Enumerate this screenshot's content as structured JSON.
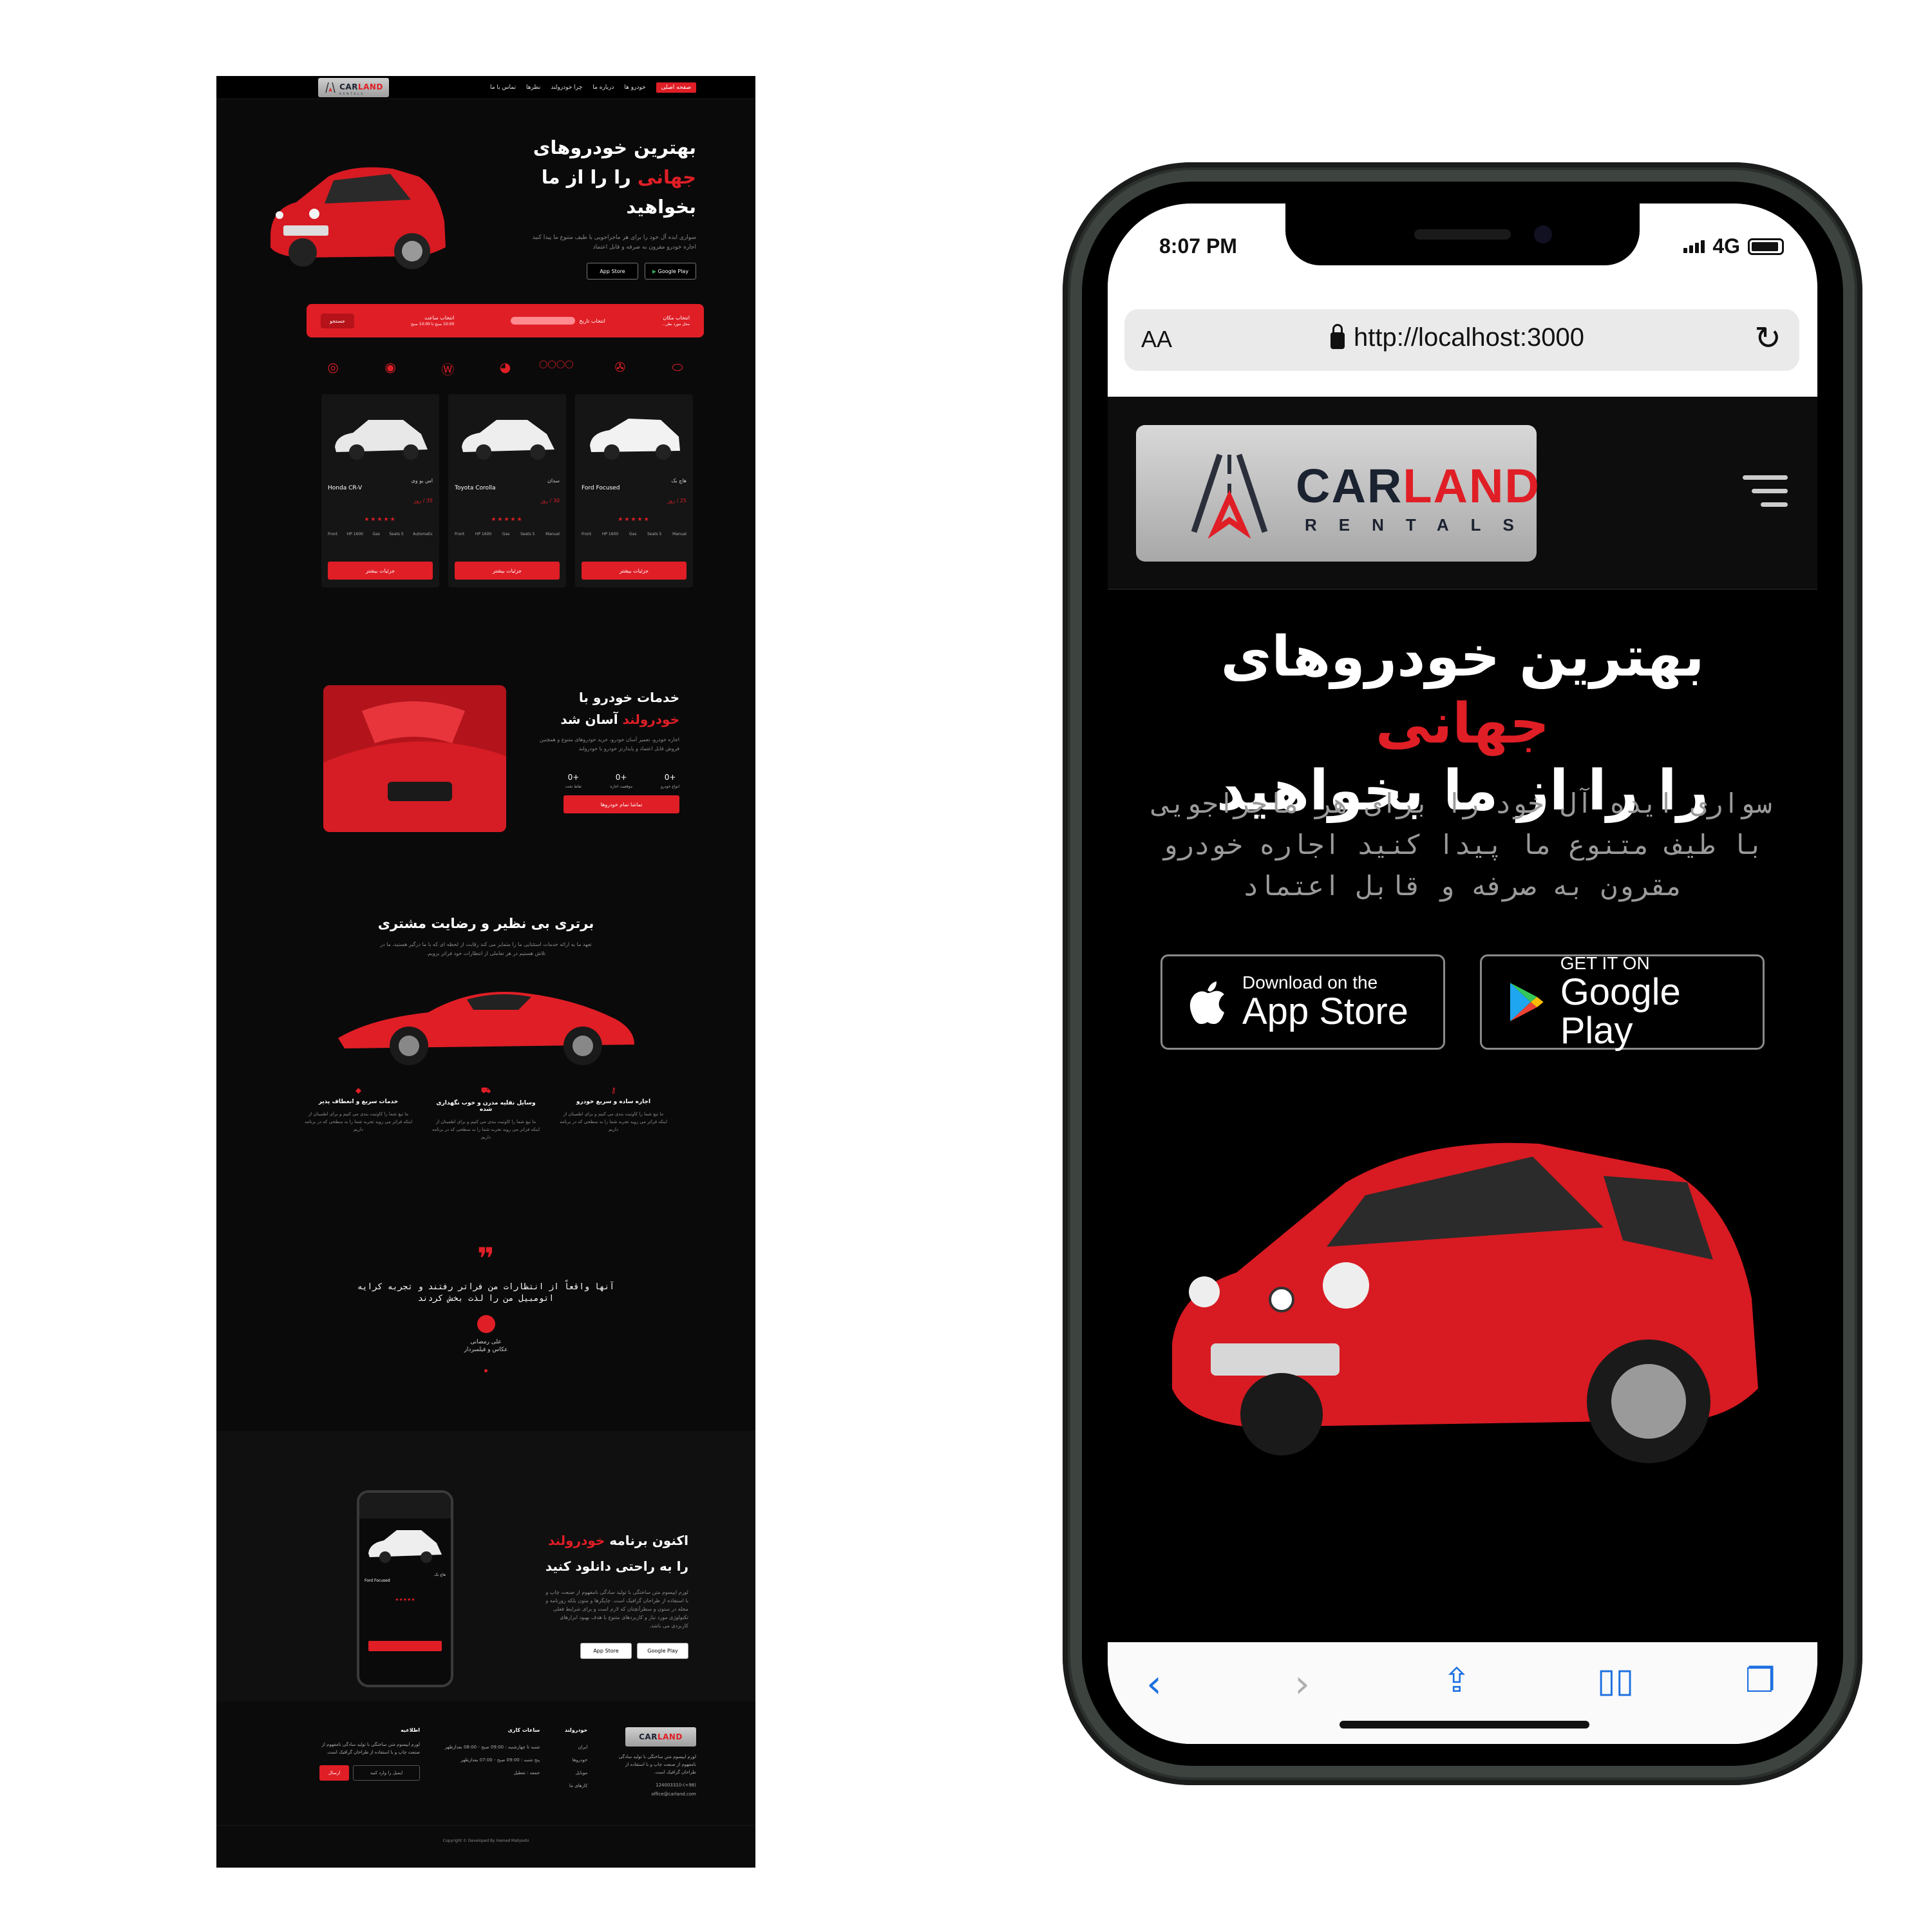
{
  "desktop": {
    "nav": {
      "logo_word_a": "CAR",
      "logo_word_b": "LAND",
      "logo_sub": "RENTALS",
      "links": [
        "صفحه اصلی",
        "خودرو ها",
        "درباره ما",
        "چرا خودرولند",
        "نظرها",
        "تماس با ما"
      ]
    },
    "hero": {
      "title_line1": "بهترین خودروهای",
      "title_red": "جهانی",
      "title_line2b": " را را از ما",
      "title_line3": "بخواهید",
      "desc": "سواری ایده آل خود را برای هر ماجراجویی با طیف متنوع ما پیدا کنید اجاره خودرو مقرون به صرفه و قابل اعتماد",
      "appstore": "App Store",
      "googleplay": "Google Play"
    },
    "search": {
      "location_label": "انتخاب مکان",
      "location_value": "محل مورد نظر...",
      "date_label": "انتخاب تاریخ",
      "time_label": "انتخاب ساعت",
      "time_value": "10:00 صبح  تا  10:00 صبح",
      "button": "جستجو"
    },
    "cards": [
      {
        "type": "هاچ بک",
        "name": "Ford Focused",
        "price": "25 / روز",
        "feats": [
          "Front",
          "HP 1600",
          "Gas",
          "Seats 5",
          "Manual"
        ],
        "cta": "جزئیات بیشتر"
      },
      {
        "type": "سدان",
        "name": "Toyota Corolla",
        "price": "30 / روز",
        "feats": [
          "Front",
          "HP 1600",
          "Gas",
          "Seats 5",
          "Manual"
        ],
        "cta": "جزئیات بیشتر"
      },
      {
        "type": "اس یو وی",
        "name": "Honda CR-V",
        "price": "35 / روز",
        "feats": [
          "Front",
          "HP 1600",
          "Gas",
          "Seats 5",
          "Automatic"
        ],
        "cta": "جزئیات بیشتر"
      }
    ],
    "services": {
      "title_a": "خدمات خودرو با",
      "title_red": "خودرولند",
      "title_b": " آسان شد",
      "desc": "اجاره خودرو، تعمیر آسان خودرو، خرید خودروهای متنوع و همچنین فروش قابل اعتماد و پایدارتر خودرو با خودرولند",
      "stats": [
        {
          "value": "+0",
          "label": "انواع خودرو"
        },
        {
          "value": "+0",
          "label": "موقعیت اجاره"
        },
        {
          "value": "+0",
          "label": "نقاط تحت"
        }
      ],
      "all_button": "تماشا تمام خودروها"
    },
    "quality": {
      "title": "برتری بی نظیر و رضایت مشتری",
      "desc": "تعهد ما به ارائه خدمات استثنایی ما را متمایز می کند رقابت از لحظه ای که با ما درگیر هستید، ما در تلاش هستیم در هر تعاملی از انتظارات خود فراتر برویم.",
      "features": [
        {
          "title": "اجاره ساده و سریع خودرو",
          "desc": "ما تیغ شما را کاوتیت بندی می کنیم و برای اطمینان از اینکه فراتر می روید تجربه شما را به سطحی که در برنامه داریم"
        },
        {
          "title": "وسایل نقلیه مدرن و خوب نگهداری شده",
          "desc": "ما تیغ شما را کاوتیت بندی می کنیم و برای اطمینان از اینکه فراتر می روید تجربه شما را به سطحی که در برنامه داریم"
        },
        {
          "title": "خدمات سریع و انعطاف پذیر",
          "desc": "ما تیغ شما را کاوتیت بندی می کنیم و برای اطمینان از اینکه فراتر می روید تجربه شما را به سطحی که در برنامه داریم"
        }
      ]
    },
    "testimonial": {
      "quote": "آنها واقعاً از انتظارات من فراتر رفتند و تجربه کرایه اتومبیل من را لذت بخش کردند",
      "name": "علی رمضانی",
      "role": "عکاس و فیلمبردار"
    },
    "app": {
      "title_a": "اکنون برنامه ",
      "title_red": "خودرولند",
      "title_b": "را به راحتی دانلود کنید",
      "desc": "لورم ایپسوم متن ساختگی با تولید سادگی نامفهوم از صنعت چاپ و با استفاده از طراحان گرافیک است. چاپگرها و متون بلکه روزنامه و مجله در ستون و سطرآنچنان که لازم است و برای شرایط فعلی تکنولوژی مورد نیاز و کاربردهای متنوع با هدف بهبود ابزارهای کاربردی می باشد.",
      "phone_car": "Ford Focused",
      "phone_type": "هاچ بک"
    },
    "footer": {
      "col1_title": "خودرولند",
      "col1_desc": "لورم ایپسوم متن ساختگی با تولید سادگی نامفهوم از صنعت چاپ و با استفاده از طراحان گرافیک است.",
      "phone": "(98+)-124003310",
      "email": "office@carland.com",
      "col2_title": "خودرولند",
      "col2_links": [
        "ایران",
        "خودروها",
        "موبایل",
        "کارهای ما"
      ],
      "col3_title": "ساعات کاری",
      "col3_lines": [
        "شنبه تا چهارشنبه : 09:00 صبح - 08:00 بعدازظهر",
        "پنج شنبه : 09:00 صبح - 07:00 بعدازظهر",
        "جمعه : تعطیل"
      ],
      "col4_title": "اطلاعیه",
      "col4_desc": "لورم ایپسوم متن ساختگی با تولید سادگی نامفهوم از صنعت چاپ و با استفاده از طراحان گرافیک است.",
      "email_placeholder": "ایمیل را وارد کنید",
      "send": "ارسال",
      "copyright": "Copyright © Developed By Hamed Mahjoobi"
    }
  },
  "phone": {
    "time": "8:07 PM",
    "network": "4G",
    "aa": "AA",
    "url": "http://localhost:3000",
    "logo_word_a": "CAR",
    "logo_word_b": "LAND",
    "logo_sub": "RENTALS",
    "title_a": "بهترین خودروهای ",
    "title_red": "جهانی",
    "title_b": "را را از ما بخواهید",
    "desc": "سواری ایده آل خود را برای هر ماجراجویی با طیف متنوع ما پیدا کنید اجاره خودرو مقرون به صرفه و قابل اعتماد",
    "appstore_small": "Download on the",
    "appstore_large": "App Store",
    "google_small": "GET IT ON",
    "google_large": "Google Play"
  },
  "colors": {
    "accent": "#e01e26",
    "background": "#000000",
    "phone_frame": "#2b302d"
  }
}
